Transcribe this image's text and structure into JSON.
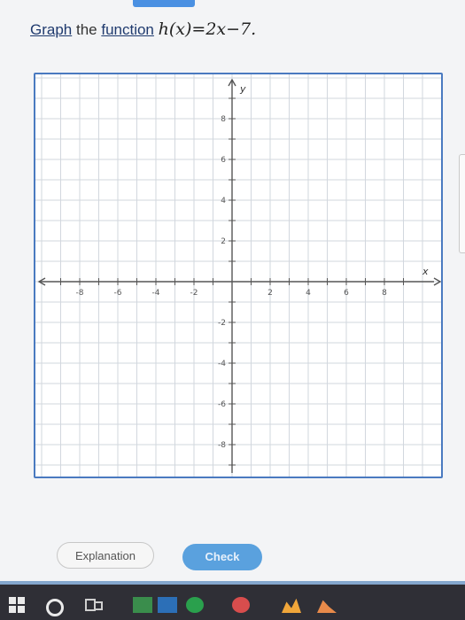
{
  "question": {
    "graph_word": "Graph",
    "the_word": " the ",
    "function_word": "function",
    "expression": "h(x)=2x−7."
  },
  "axes": {
    "x_label": "x",
    "y_label": "y",
    "x_ticks": [
      "-8",
      "-6",
      "-4",
      "-2",
      "2",
      "4",
      "6",
      "8"
    ],
    "y_ticks_pos": [
      "8",
      "6",
      "4",
      "2"
    ],
    "y_ticks_neg": [
      "-2",
      "-4",
      "-6",
      "-8"
    ]
  },
  "buttons": {
    "explanation": "Explanation",
    "check": "Check"
  },
  "colors": {
    "panel_border": "#4a7ac0",
    "check_button": "#5aa1de",
    "taskbar": "#2f2f36"
  },
  "taskbar_icons": [
    "windows-icon",
    "cortana-icon",
    "task-view-icon",
    "app-icon",
    "app-icon",
    "edge-icon",
    "chrome-icon",
    "app-icon",
    "app-icon"
  ]
}
